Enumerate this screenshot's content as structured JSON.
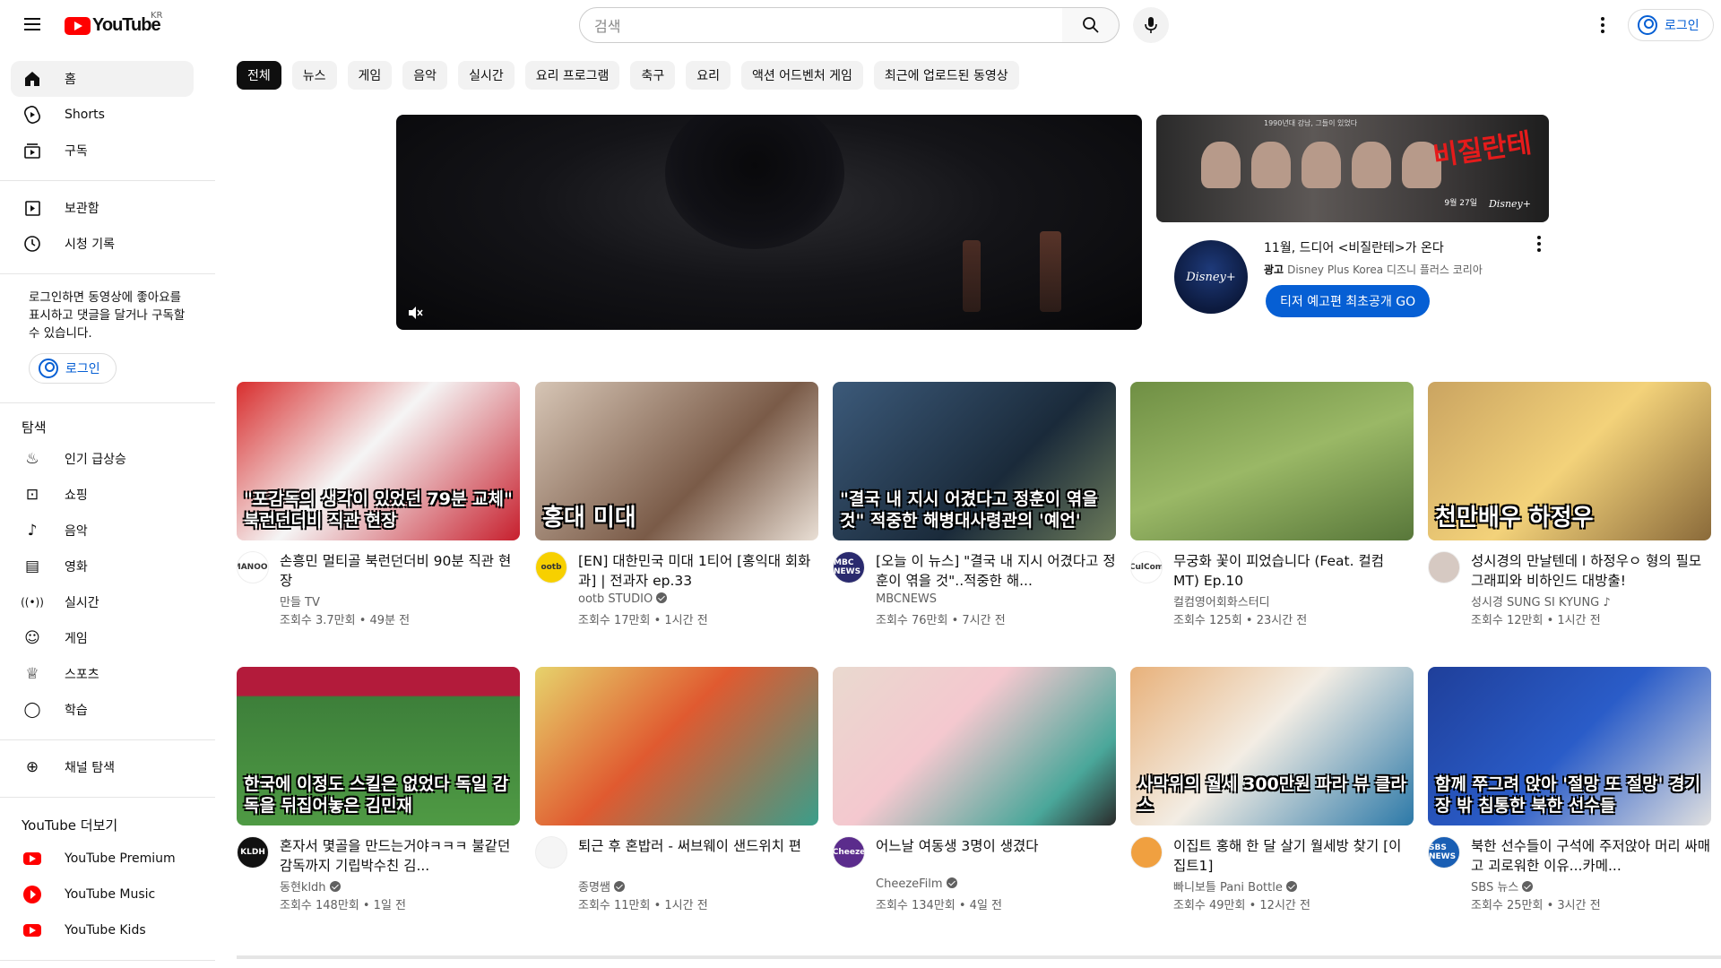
{
  "header": {
    "logo_text": "YouTube",
    "country_code": "KR",
    "search_placeholder": "검색",
    "signin_label": "로그인"
  },
  "sidebar": {
    "main": [
      {
        "label": "홈",
        "icon": "home-icon"
      },
      {
        "label": "Shorts",
        "icon": "shorts-icon"
      },
      {
        "label": "구독",
        "icon": "subscriptions-icon"
      }
    ],
    "library": [
      {
        "label": "보관함",
        "icon": "library-icon"
      },
      {
        "label": "시청 기록",
        "icon": "history-icon"
      }
    ],
    "signin_note": "로그인하면 동영상에 좋아요를 표시하고 댓글을 달거나 구독할 수 있습니다.",
    "signin_label": "로그인",
    "explore_heading": "탐색",
    "explore": [
      {
        "label": "인기 급상승",
        "icon": "trending-icon"
      },
      {
        "label": "쇼핑",
        "icon": "shopping-icon"
      },
      {
        "label": "음악",
        "icon": "music-icon"
      },
      {
        "label": "영화",
        "icon": "movies-icon"
      },
      {
        "label": "실시간",
        "icon": "live-icon"
      },
      {
        "label": "게임",
        "icon": "gaming-icon"
      },
      {
        "label": "스포츠",
        "icon": "sports-icon"
      },
      {
        "label": "학습",
        "icon": "learning-icon"
      }
    ],
    "browse_channels": "채널 탐색",
    "more_heading": "YouTube 더보기",
    "more": [
      {
        "label": "YouTube Premium"
      },
      {
        "label": "YouTube Music"
      },
      {
        "label": "YouTube Kids"
      }
    ]
  },
  "chips": [
    "전체",
    "뉴스",
    "게임",
    "음악",
    "실시간",
    "요리 프로그램",
    "축구",
    "요리",
    "액션 어드벤처 게임",
    "최근에 업로드된 동영상"
  ],
  "promo": {
    "thumb_title": "비질란테",
    "thumb_date": "9월 27일",
    "thumb_brand": "Disney+",
    "thumb_top": "1990년대 강남, 그들이 있었다",
    "avatar_text": "Disney+",
    "title": "11월, 드디어 <비질란테>가 온다",
    "ad_label": "광고",
    "advertiser": "Disney Plus Korea 디즈니 플러스 코리아",
    "cta": "티저 예고편 최초공개 GO"
  },
  "videos": [
    {
      "thumb_caption": "\"포감독의 생각이 있었던 79분 교체\" 북런던더비 직관 현장",
      "avatar_text": "MANOOL",
      "avatar_color": "#ffffff",
      "title": "손흥민 멀티골 북런던더비 90분 직관 현장",
      "channel": "만들 TV",
      "verified": false,
      "stats": "조회수 3.7만회 • 49분 전",
      "bg": "linear-gradient(135deg,#d82e2e,#f5f5f5 45%,#c71f2d)"
    },
    {
      "thumb_caption": "홍대 미대",
      "avatar_text": "ootb",
      "avatar_color": "#f7d000",
      "title": "[EN] 대한민국 미대 1티어 [홍익대 회화과] | 전과자 ep.33",
      "channel": "ootb STUDIO",
      "verified": true,
      "stats": "조회수 17만회 • 1시간 전",
      "bg": "linear-gradient(135deg,#d6c5b5,#7a5b48 60%,#e9dfd5)"
    },
    {
      "thumb_caption": "\"결국 내 지시 어겼다고 정훈이 엮을 것\" 적중한 해병대사령관의 '예언'",
      "avatar_text": "MBC NEWS",
      "avatar_color": "#2a2a6e",
      "title": "[오늘 이 뉴스] \"결국 내 지시 어겼다고 정훈이 엮을 것\"..적중한 해...",
      "channel": "MBCNEWS",
      "verified": false,
      "stats": "조회수 76만회 • 7시간 전",
      "bg": "linear-gradient(135deg,#3c5a7a,#1a2a3a 60%,#6b7a5a)"
    },
    {
      "thumb_caption": "",
      "avatar_text": "CulCom",
      "avatar_color": "#ffffff",
      "title": "무궁화 꽃이 피었습니다 (Feat. 컬컴 MT) Ep.10",
      "channel": "컬컴영어회화스터디",
      "verified": false,
      "stats": "조회수 125회 • 23시간 전",
      "bg": "linear-gradient(160deg,#6f8f44,#9ab866 50%,#58773a)"
    },
    {
      "thumb_caption": "천만배우 하정우",
      "avatar_text": "",
      "avatar_color": "#d6c9c2",
      "title": "성시경의 만날텐데 l 하정우ㅇ 형의 필모그래피와 비하인드 대방출!",
      "channel": "성시경 SUNG SI KYUNG ♪",
      "verified": false,
      "stats": "조회수 12만회 • 1시간 전",
      "bg": "linear-gradient(135deg,#caa461,#f3d27a 50%,#8a6a3a)"
    },
    {
      "thumb_caption": "한국에 이정도 스킬은 없었다 독일 감독을 뒤집어놓은 김민재",
      "avatar_text": "KLDH",
      "avatar_color": "#111111",
      "title": "혼자서 몇골을 만드는거야ㅋㅋㅋ 불같던 감독까지 기립박수친 김...",
      "channel": "동현kldh",
      "verified": true,
      "stats": "조회수 148만회 • 1일 전",
      "bg": "linear-gradient(180deg,#b31b3b 0%,#b31b3b 18%,#3d7f3a 19%,#4f9a44 100%)"
    },
    {
      "thumb_caption": "",
      "avatar_text": "",
      "avatar_color": "#f5f5f5",
      "title": "퇴근 후 혼밥러 - 써브웨이 샌드위치 편",
      "channel": "종명쌤",
      "verified": true,
      "stats": "조회수 11만회 • 1시간 전",
      "bg": "linear-gradient(135deg,#e6d36c,#e05a30 45%,#3a9e8a)"
    },
    {
      "thumb_caption": "",
      "avatar_text": "Cheeze",
      "avatar_color": "#5b2c8c",
      "title": "어느날 여동생 3명이 생겼다",
      "channel": "CheezeFilm",
      "verified": true,
      "stats": "조회수 134만회 • 4일 전",
      "bg": "linear-gradient(135deg,#e9d9cf,#f4c8cf 40%,#4aa79a 80%,#2a2a2a)"
    },
    {
      "thumb_caption": "사막위의 월세 300만원 파라 뷰 클라스",
      "avatar_text": "",
      "avatar_color": "#f0a040",
      "title": "이집트 홍해 한 달 살기 월세방 찾기 [이집트1]",
      "channel": "빠니보틀 Pani Bottle",
      "verified": true,
      "stats": "조회수 49만회 • 12시간 전",
      "bg": "linear-gradient(135deg,#e8b17a,#f3ede4 45%,#2c79a8)"
    },
    {
      "thumb_caption": "함께 쭈그려 앉아 '절망 또 절망' 경기장 밖 침통한 북한 선수들",
      "avatar_text": "SBS NEWS",
      "avatar_color": "#1a5fb4",
      "title": "북한 선수들이 구석에 주저앉아 머리 싸매고 괴로워한 이유...카메...",
      "channel": "SBS 뉴스",
      "verified": true,
      "stats": "조회수 25만회 • 3시간 전",
      "bg": "linear-gradient(135deg,#1f3f9a,#2a5cc8 50%,#e0e0e0)"
    }
  ]
}
